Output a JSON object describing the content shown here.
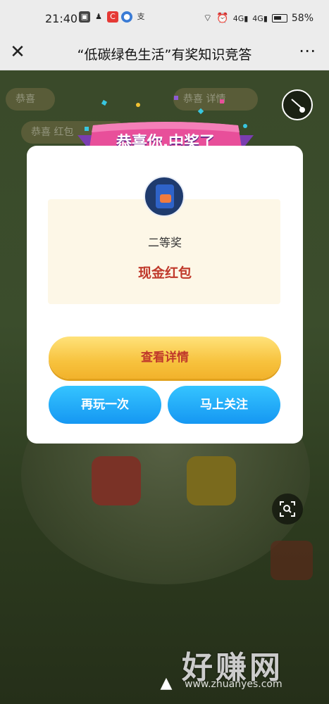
{
  "status_bar": {
    "time": "21:40",
    "battery": "58%",
    "left_icons": [
      "image-icon",
      "qq-icon",
      "c-app-icon",
      "globe-icon",
      "alipay-icon"
    ],
    "right_icons": [
      "cast-icon",
      "alarm-icon",
      "signal-4g-icon",
      "signal-4g-icon-2",
      "battery-icon"
    ]
  },
  "nav": {
    "title": "“低碳绿色生活”有奖知识竞答"
  },
  "modal": {
    "banner": "恭喜你,中奖了",
    "prize_level": "二等奖",
    "prize_name": "现金红包",
    "buttons": {
      "detail": "查看详情",
      "play_again": "再玩一次",
      "follow": "马上关注"
    }
  },
  "background": {
    "tab_1": "恭喜",
    "tab_2": "恭喜  详情",
    "tab_3": "恭喜  红包"
  },
  "watermark": {
    "main": "好赚网",
    "url": "www.zhuanyes.com"
  },
  "colors": {
    "accent_red": "#c0392b",
    "button_blue": "#1597f2",
    "button_yellow": "#f7c23d"
  }
}
